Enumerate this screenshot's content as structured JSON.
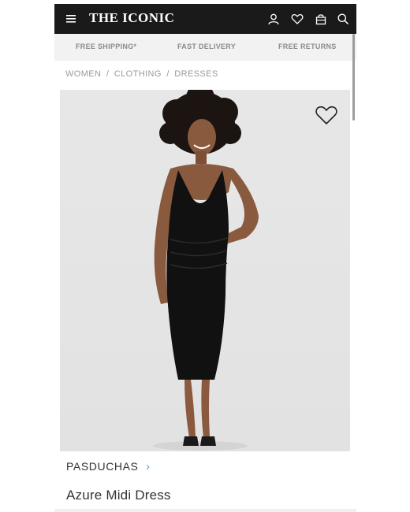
{
  "header": {
    "logo": "THE ICONIC",
    "icons": [
      "menu-icon",
      "account-icon",
      "wishlist-icon",
      "bag-icon",
      "search-icon"
    ],
    "bg_color": "#1a1a1a"
  },
  "benefits": {
    "items": [
      {
        "label": "FREE SHIPPING*"
      },
      {
        "label": "FAST DELIVERY"
      },
      {
        "label": "FREE RETURNS"
      }
    ]
  },
  "breadcrumb": {
    "items": [
      "WOMEN",
      "CLOTHING",
      "DRESSES"
    ],
    "separator": "/"
  },
  "product": {
    "brand": "PASDUCHAS",
    "name": "Azure Midi Dress",
    "image_icon": "model-in-black-dress"
  },
  "colors": {
    "accent_chevron": "#6aa0c8"
  }
}
